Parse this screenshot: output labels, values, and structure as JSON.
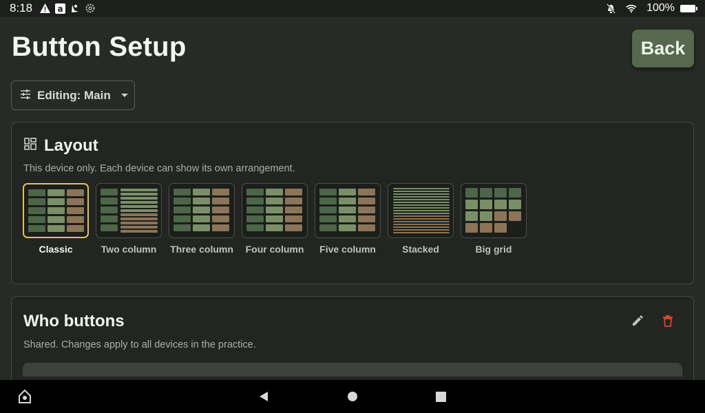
{
  "status": {
    "time": "8:18",
    "battery": "100%"
  },
  "page": {
    "title": "Button Setup",
    "back_label": "Back"
  },
  "editing": {
    "label": "Editing: Main"
  },
  "layout_card": {
    "title": "Layout",
    "subtitle": "This device only. Each device can show its own arrangement.",
    "selected": "Classic",
    "options": [
      {
        "label": "Classic"
      },
      {
        "label": "Two column"
      },
      {
        "label": "Three column"
      },
      {
        "label": "Four column"
      },
      {
        "label": "Five column"
      },
      {
        "label": "Stacked"
      },
      {
        "label": "Big grid"
      }
    ]
  },
  "who_card": {
    "title": "Who buttons",
    "subtitle": "Shared. Changes apply to all devices in the practice."
  },
  "colors": {
    "green_dark": "#4d6548",
    "green_light": "#7a8f68",
    "tan": "#8c7458",
    "accent": "#e2c25c",
    "delete": "#d9472b"
  }
}
